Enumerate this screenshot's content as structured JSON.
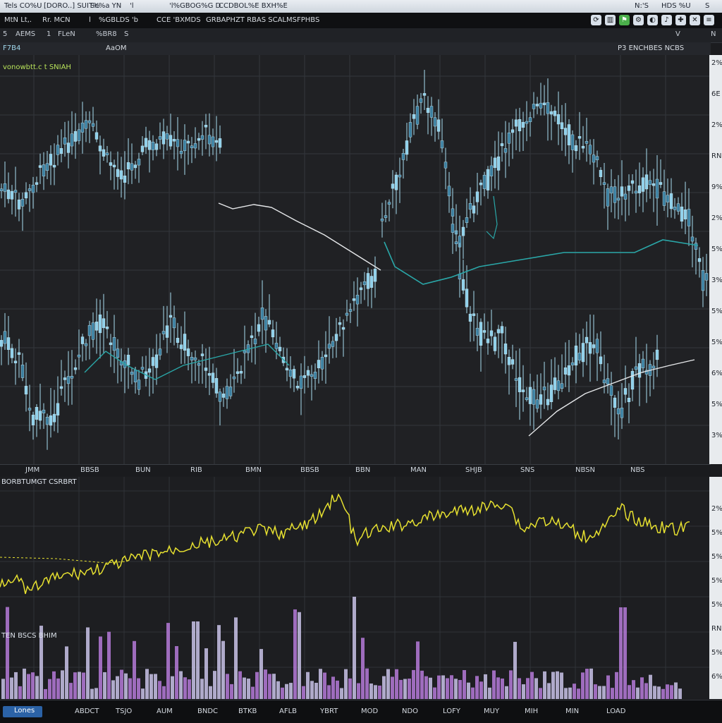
{
  "window": {
    "title_parts": [
      "Tels CO%U",
      "[DORO..] SUIT%",
      "Sc%a YN",
      "'l",
      "'l%GBOG%G D",
      "CCDBOL%E BXH%E"
    ],
    "title_right": [
      "N:'S",
      "HDS %U",
      "S"
    ]
  },
  "toolbar": {
    "items": [
      "MtN Lt,.",
      "Rr. MCN",
      "l",
      "%GBLDS 'b",
      "CCE 'BXMDS",
      "GRBAPHZT RBAS SCALMSFPHBS"
    ],
    "tab_labels": [
      "5",
      "AEMS",
      "1",
      "FLeN",
      "%BR8",
      "S"
    ],
    "right_labels": [
      "V",
      "N"
    ]
  },
  "subheader": {
    "left": "F7B4",
    "label": "AaOM",
    "right": "P3 ENCHBES NCBS"
  },
  "main_chart": {
    "legend": "vonowbtt.c t SNIAH",
    "x_labels": [
      "JMM",
      "BBSB",
      "BUN",
      "RIB",
      "BMN",
      "BBSB",
      "BBN",
      "MAN",
      "SHJB",
      "SNS",
      "NBSN",
      "NBS"
    ],
    "y_labels": [
      "2%",
      "6E",
      "2%",
      "RN",
      "9%",
      "2%",
      "5%",
      "3%",
      "5%",
      "5%",
      "6%",
      "5%",
      "3%"
    ]
  },
  "lower_chart": {
    "legend": "BORBTUMGT CSRBRT",
    "sub_legend": "TEN BSCS BHIM",
    "y_labels": [
      "2%",
      "5%",
      "5%",
      "5%",
      "5%",
      "RN",
      "5%",
      "6%"
    ]
  },
  "bottom_bar": {
    "tab": "Lones",
    "labels": [
      "ABDCT",
      "TSJO",
      "AUM",
      "BNDC",
      "BTKB",
      "AFLB",
      "YBRT",
      "MOD",
      "NDO",
      "LOFY",
      "MUY",
      "MIH",
      "MIN",
      "LOAD"
    ]
  },
  "colors": {
    "candle": "#8fd0ea",
    "candle_dark": "#3a7fa0",
    "ma_teal": "#2aa7a8",
    "ma_white": "#e6e8ea",
    "oscillator": "#e6e030",
    "volume_a": "#b57ad8",
    "volume_b": "#c9c3e8"
  },
  "icons": [
    "refresh-icon",
    "chart-icon",
    "flag-icon",
    "settings-icon",
    "color-icon",
    "bell-icon",
    "cross-icon",
    "close-icon",
    "menu-icon",
    "up-arrow-icon"
  ]
}
